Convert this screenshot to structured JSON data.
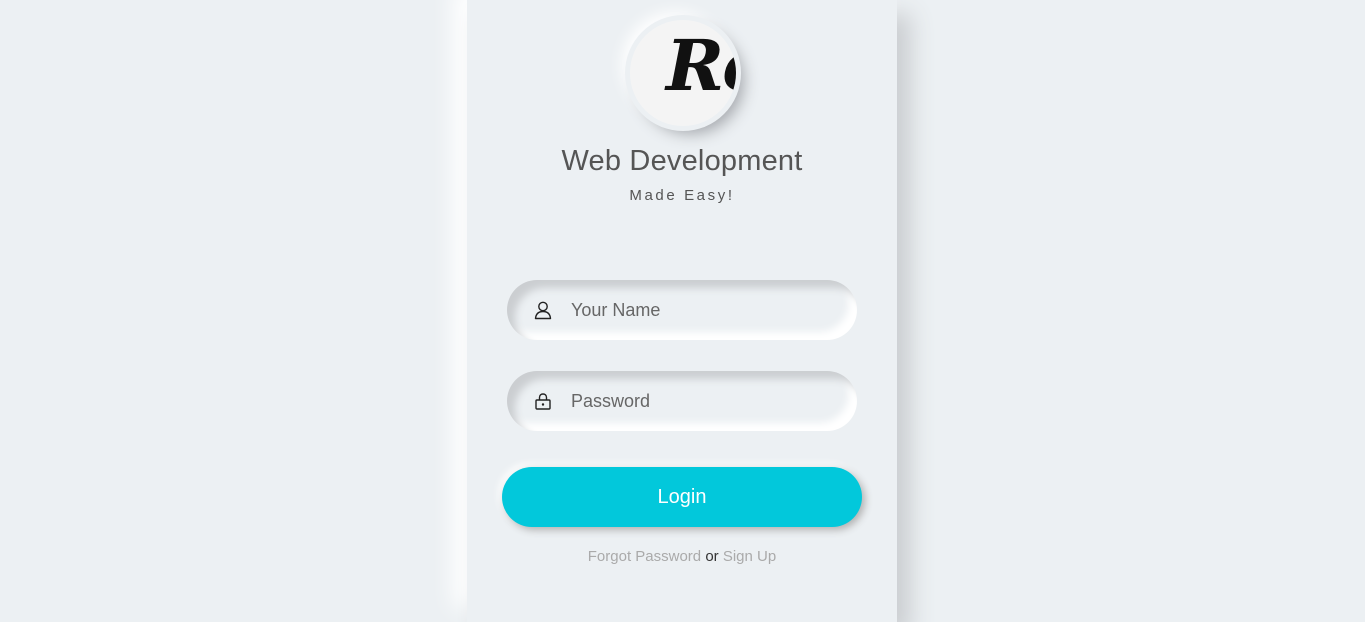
{
  "logo": {
    "text": "Ro"
  },
  "brand": {
    "title": "Web Development",
    "subtitle": "Made Easy!"
  },
  "form": {
    "name": {
      "placeholder": "Your Name",
      "value": "",
      "icon": "user-icon"
    },
    "password": {
      "placeholder": "Password",
      "value": "",
      "icon": "lock-icon"
    },
    "login_label": "Login"
  },
  "links": {
    "forgot": "Forgot Password",
    "separator": " or ",
    "signup": "Sign Up"
  },
  "colors": {
    "background": "#ecf0f3",
    "accent": "#02c8db",
    "text": "#555555",
    "link": "#aaaaaa"
  }
}
